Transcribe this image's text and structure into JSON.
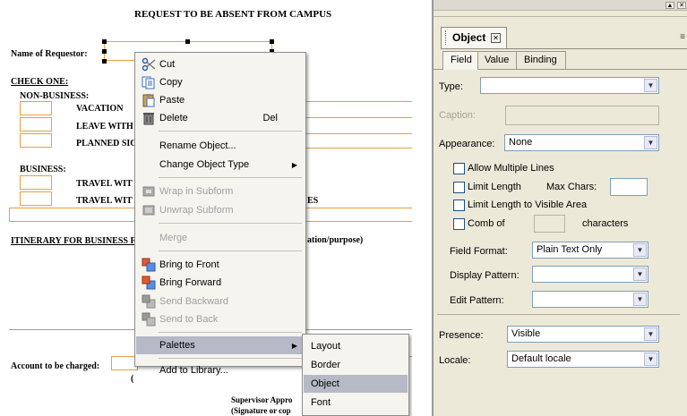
{
  "document": {
    "title": "REQUEST TO BE ABSENT FROM CAMPUS",
    "name_label": "Name of Requestor:",
    "check_one": "CHECK ONE:",
    "non_business": "NON-BUSINESS:",
    "vacation": "VACATION",
    "leave_partial": "LEAVE WITH",
    "planned_partial": "PLANNED SIC",
    "business": "BUSINESS:",
    "travel1_partial": "TRAVEL WIT",
    "travel2_partial": "TRAVEL WIT",
    "es_partial": "ES",
    "itinerary_partial": "ITINERARY FOR BUSINESS F",
    "destination_partial": "ation/purpose)",
    "account_label": "Account to be charged:",
    "paren_partial": "(",
    "supervisor_line1": "Supervisor Appro",
    "supervisor_line2": "(Signature or cop"
  },
  "context_menu": {
    "cut": "Cut",
    "copy": "Copy",
    "paste": "Paste",
    "delete": "Delete",
    "delete_shortcut": "Del",
    "rename": "Rename Object...",
    "change_type": "Change Object Type",
    "wrap": "Wrap in Subform",
    "unwrap": "Unwrap Subform",
    "merge": "Merge",
    "bring_front": "Bring to Front",
    "bring_forward": "Bring Forward",
    "send_backward": "Send Backward",
    "send_back": "Send to Back",
    "palettes": "Palettes",
    "add_library": "Add to Library..."
  },
  "palettes_submenu": {
    "layout": "Layout",
    "border": "Border",
    "object": "Object",
    "font": "Font"
  },
  "palette": {
    "title": "Object",
    "tabs": [
      "Field",
      "Value",
      "Binding"
    ],
    "type_label": "Type:",
    "type_value": "",
    "caption_label": "Caption:",
    "appearance_label": "Appearance:",
    "appearance_value": "None",
    "allow_multiple_lines": "Allow Multiple Lines",
    "limit_length": "Limit Length",
    "max_chars": "Max Chars:",
    "limit_visible": "Limit Length to Visible Area",
    "comb_of": "Comb of",
    "characters": "characters",
    "field_format_label": "Field Format:",
    "field_format_value": "Plain Text Only",
    "display_pattern_label": "Display Pattern:",
    "edit_pattern_label": "Edit Pattern:",
    "presence_label": "Presence:",
    "presence_value": "Visible",
    "locale_label": "Locale:",
    "locale_value": "Default locale"
  },
  "colors": {
    "form_field_border": "#e8a040",
    "menu_highlight": "#b7b9c6",
    "palette_bg": "#ece9d8",
    "checkbox_border": "#1c5180"
  },
  "icons": [
    "scissors-icon",
    "copy-icon",
    "paste-icon",
    "delete-icon",
    "wrap-icon",
    "unwrap-icon",
    "bring-front-icon",
    "bring-forward-icon",
    "send-backward-icon",
    "send-back-icon",
    "chevron-right-icon",
    "dropdown-arrow-icon",
    "close-tab-icon"
  ]
}
